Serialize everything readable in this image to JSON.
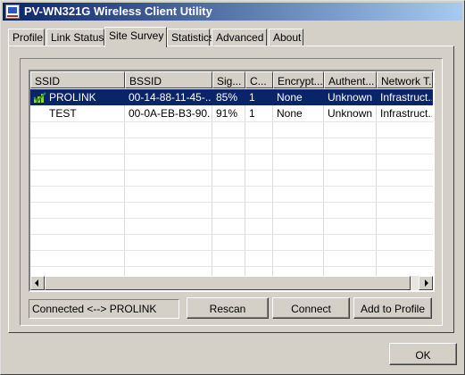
{
  "window": {
    "title": "PV-WN321G Wireless Client Utility"
  },
  "tabs": [
    {
      "label": "Profile"
    },
    {
      "label": "Link Status"
    },
    {
      "label": "Site Survey"
    },
    {
      "label": "Statistics"
    },
    {
      "label": "Advanced"
    },
    {
      "label": "About"
    }
  ],
  "active_tab": "Site Survey",
  "table": {
    "columns": [
      "SSID",
      "BSSID",
      "Sig...",
      "C...",
      "Encrypt...",
      "Authent...",
      "Network T..."
    ],
    "rows": [
      {
        "ssid": "PROLINK",
        "bssid": "00-14-88-11-45-...",
        "signal": "85%",
        "channel": "1",
        "encryption": "None",
        "authentication": "Unknown",
        "network_type": "Infrastruct...",
        "selected": true,
        "icon": "connected-signal-icon"
      },
      {
        "ssid": "TEST",
        "bssid": "00-0A-EB-B3-90...",
        "signal": "91%",
        "channel": "1",
        "encryption": "None",
        "authentication": "Unknown",
        "network_type": "Infrastruct...",
        "selected": false
      }
    ]
  },
  "status": {
    "text": "Connected <--> PROLINK"
  },
  "buttons": {
    "rescan": "Rescan",
    "connect": "Connect",
    "add_to_profile": "Add to Profile",
    "ok": "OK"
  },
  "scrollbar": {
    "left_icon": "arrow-left-icon",
    "right_icon": "arrow-right-icon"
  },
  "colors": {
    "selection": "#0a246a",
    "face": "#d4d0c8",
    "title_gradient_start": "#0a246a",
    "title_gradient_end": "#a6caf0"
  }
}
